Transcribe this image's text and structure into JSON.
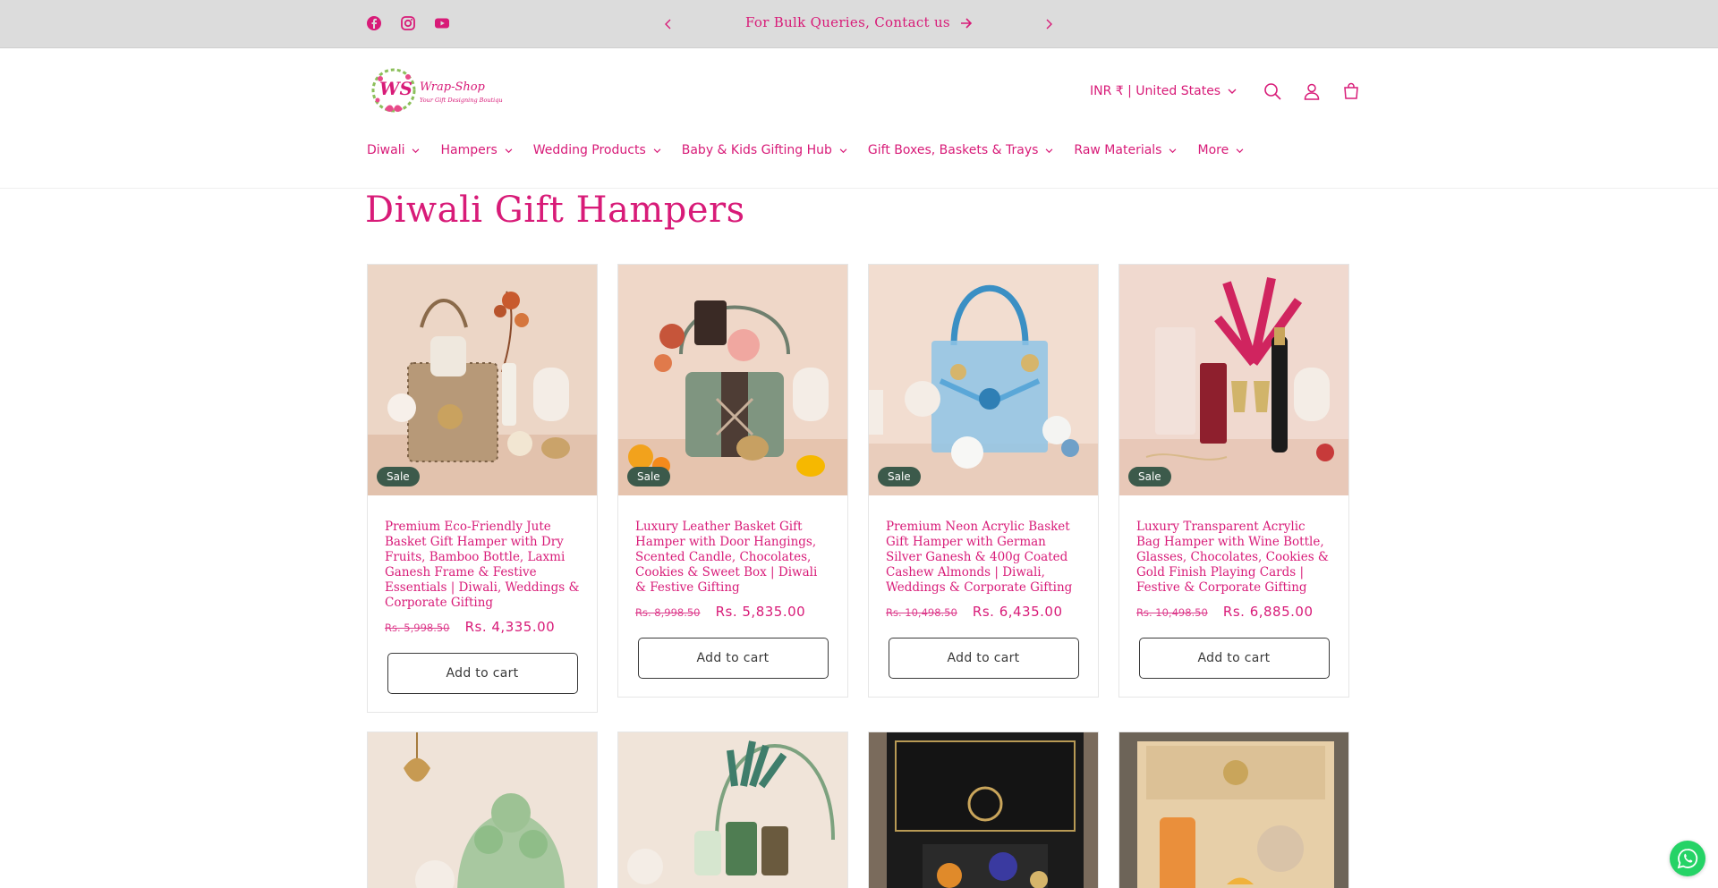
{
  "announcement": {
    "text": "For Bulk Queries, Contact us",
    "social": [
      "facebook-icon",
      "instagram-icon",
      "youtube-icon"
    ]
  },
  "brand": {
    "logo_initials": "WS",
    "logo_name": "Wrap-Shop",
    "logo_tagline": "Your Gift Designing Boutique"
  },
  "header": {
    "currency": "INR ₹ | United States",
    "icons": [
      "search-icon",
      "account-icon",
      "cart-icon"
    ]
  },
  "nav": [
    {
      "label": "Diwali"
    },
    {
      "label": "Hampers"
    },
    {
      "label": "Wedding Products"
    },
    {
      "label": "Baby & Kids Gifting Hub"
    },
    {
      "label": "Gift Boxes, Baskets & Trays"
    },
    {
      "label": "Raw Materials"
    },
    {
      "label": "More"
    }
  ],
  "page": {
    "title": "Diwali Gift Hampers"
  },
  "products": [
    {
      "title": "Premium Eco-Friendly Jute Basket Gift Hamper with Dry Fruits, Bamboo Bottle, Laxmi Ganesh Frame & Festive Essentials | Diwali, Weddings & Corporate Gifting",
      "old_price": "Rs. 5,998.50",
      "price": "Rs. 4,335.00",
      "badge": "Sale",
      "button": "Add to cart"
    },
    {
      "title": "Luxury Leather Basket Gift Hamper with Door Hangings, Scented Candle, Chocolates, Cookies & Sweet Box | Diwali & Festive Gifting",
      "old_price": "Rs. 8,998.50",
      "price": "Rs. 5,835.00",
      "badge": "Sale",
      "button": "Add to cart"
    },
    {
      "title": "Premium Neon Acrylic Basket Gift Hamper with German Silver Ganesh & 400g Coated Cashew Almonds | Diwali, Weddings & Corporate Gifting",
      "old_price": "Rs. 10,498.50",
      "price": "Rs. 6,435.00",
      "badge": "Sale",
      "button": "Add to cart"
    },
    {
      "title": "Luxury Transparent Acrylic Bag Hamper with Wine Bottle, Glasses, Chocolates, Cookies & Gold Finish Playing Cards | Festive & Corporate Gifting",
      "old_price": "Rs. 10,498.50",
      "price": "Rs. 6,885.00",
      "badge": "Sale",
      "button": "Add to cart"
    }
  ],
  "colors": {
    "brand": "#d81b78",
    "badge": "#3c5a4b",
    "topbar": "#dcdcdc"
  }
}
